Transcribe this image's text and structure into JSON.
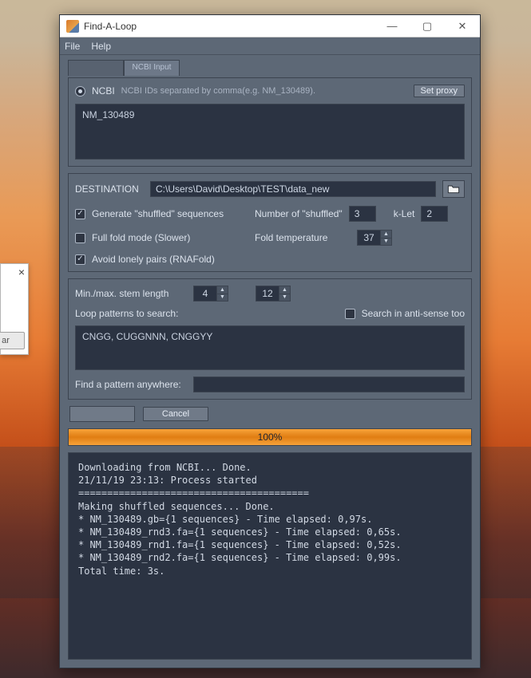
{
  "window": {
    "title": "Find-A-Loop",
    "menu": {
      "file": "File",
      "help": "Help"
    }
  },
  "tabs": {
    "blank": "",
    "ncbi": "NCBI Input"
  },
  "source": {
    "ncbi_label": "NCBI",
    "ncbi_hint": "NCBI IDs separated by comma(e.g. NM_130489).",
    "set_proxy": "Set proxy",
    "ids_value": "NM_130489"
  },
  "dest": {
    "label": "DESTINATION",
    "path": "C:\\Users\\David\\Desktop\\TEST\\data_new"
  },
  "opts": {
    "gen_shuffled_label": "Generate \"shuffled\" sequences",
    "gen_shuffled": true,
    "num_shuffled_label": "Number of \"shuffled\"",
    "num_shuffled": "3",
    "klet_label": "k-Let",
    "klet": "2",
    "full_fold_label": "Full fold mode (Slower)",
    "full_fold": false,
    "fold_temp_label": "Fold temperature",
    "fold_temp": "37",
    "avoid_lonely_label": "Avoid lonely pairs (RNAFold)",
    "avoid_lonely": true
  },
  "search": {
    "stem_label": "Min./max. stem length",
    "stem_min": "4",
    "stem_max": "12",
    "patterns_label": "Loop patterns to search:",
    "antisense_label": "Search in anti-sense too",
    "antisense": false,
    "patterns_value": "CNGG, CUGGNNN, CNGGYY",
    "anywhere_label": "Find a pattern anywhere:",
    "anywhere_value": ""
  },
  "actions": {
    "cancel": "Cancel"
  },
  "progress": {
    "text": "100%"
  },
  "log": "Downloading from NCBI... Done.\n21/11/19 23:13: Process started\n========================================\nMaking shuffled sequences... Done.\n* NM_130489.gb={1 sequences} - Time elapsed: 0,97s.\n* NM_130489_rnd3.fa={1 sequences} - Time elapsed: 0,65s.\n* NM_130489_rnd1.fa={1 sequences} - Time elapsed: 0,52s.\n* NM_130489_rnd2.fa={1 sequences} - Time elapsed: 0,99s.\nTotal time: 3s.",
  "ghost": {
    "btn": "ar"
  }
}
